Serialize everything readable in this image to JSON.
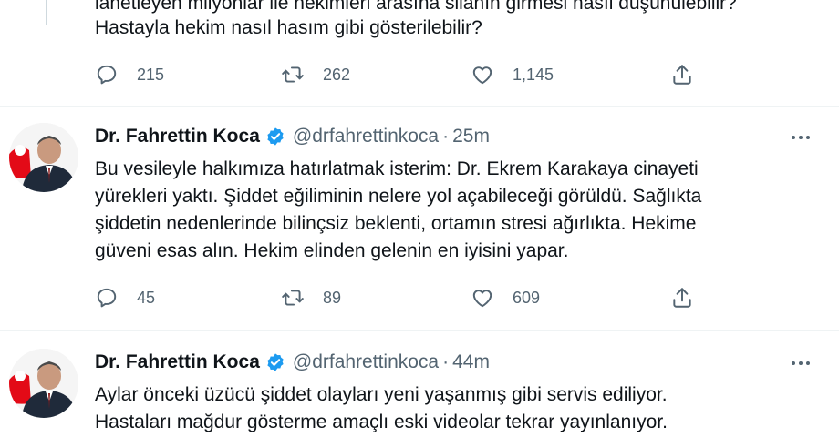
{
  "tweet0": {
    "text_lines": [
      "lanetleyen milyonlar ile hekimleri arasına silahın girmesi nasıl düşünülebilir?",
      "Hastayla hekim nasıl hasım gibi gösterilebilir?"
    ],
    "replies": "215",
    "retweets": "262",
    "likes": "1,145"
  },
  "tweet1": {
    "name": "Dr. Fahrettin Koca",
    "handle": "@drfahrettinkoca",
    "time": "25m",
    "text_lines": [
      "Bu vesileyle halkımıza hatırlatmak isterim: Dr. Ekrem Karakaya cinayeti",
      "yürekleri yaktı. Şiddet eğiliminin nelere yol açabileceği görüldü. Sağlıkta",
      "şiddetin nedenlerinde bilinçsiz beklenti, ortamın stresi ağırlıkta. Hekime",
      "güveni esas alın. Hekim elinden gelenin en iyisini yapar."
    ],
    "replies": "45",
    "retweets": "89",
    "likes": "609"
  },
  "tweet2": {
    "name": "Dr. Fahrettin Koca",
    "handle": "@drfahrettinkoca",
    "time": "44m",
    "text_lines": [
      "Aylar önceki üzücü şiddet olayları yeni yaşanmış gibi servis ediliyor.",
      "Hastaları mağdur gösterme amaçlı eski videolar tekrar yayınlanıyor."
    ]
  },
  "colors": {
    "text": "#0f1419",
    "secondary": "#536471",
    "verified": "#1d9bf0",
    "divider": "#eff3f4"
  },
  "icons": [
    "reply-icon",
    "retweet-icon",
    "like-icon",
    "share-icon",
    "verified-badge-icon",
    "more-icon"
  ]
}
